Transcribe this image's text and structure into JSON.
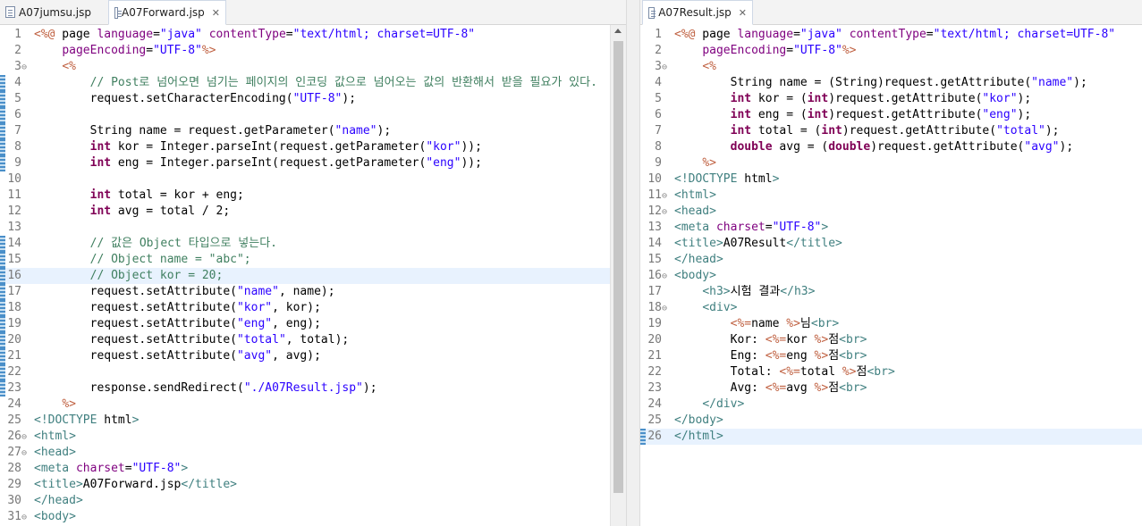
{
  "editor_left": {
    "tabs": [
      {
        "label": "A07jumsu.jsp",
        "active": false
      },
      {
        "label": "A07Forward.jsp",
        "active": true
      }
    ],
    "close_glyph": "✕",
    "highlight_line": 16,
    "lines": [
      {
        "n": "1",
        "f": "",
        "t": "<%@ page language=\"java\" contentType=\"text/html; charset=UTF-8\""
      },
      {
        "n": "2",
        "f": "",
        "t": "    pageEncoding=\"UTF-8\"%>"
      },
      {
        "n": "3",
        "f": "⊖",
        "t": "    <%"
      },
      {
        "n": "4",
        "f": "",
        "t": "        // Post로 넘어오면 넘기는 페이지의 인코딩 값으로 넘어오는 값의 반환해서 받을 필요가 있다."
      },
      {
        "n": "5",
        "f": "",
        "t": "        request.setCharacterEncoding(\"UTF-8\");"
      },
      {
        "n": "6",
        "f": "",
        "t": ""
      },
      {
        "n": "7",
        "f": "",
        "t": "        String name = request.getParameter(\"name\");"
      },
      {
        "n": "8",
        "f": "",
        "t": "        int kor = Integer.parseInt(request.getParameter(\"kor\"));"
      },
      {
        "n": "9",
        "f": "",
        "t": "        int eng = Integer.parseInt(request.getParameter(\"eng\"));"
      },
      {
        "n": "10",
        "f": "",
        "t": ""
      },
      {
        "n": "11",
        "f": "",
        "t": "        int total = kor + eng;"
      },
      {
        "n": "12",
        "f": "",
        "t": "        int avg = total / 2;"
      },
      {
        "n": "13",
        "f": "",
        "t": ""
      },
      {
        "n": "14",
        "f": "",
        "t": "        // 값은 Object 타입으로 넣는다."
      },
      {
        "n": "15",
        "f": "",
        "t": "        // Object name = \"abc\";"
      },
      {
        "n": "16",
        "f": "",
        "t": "        // Object kor = 20;"
      },
      {
        "n": "17",
        "f": "",
        "t": "        request.setAttribute(\"name\", name);"
      },
      {
        "n": "18",
        "f": "",
        "t": "        request.setAttribute(\"kor\", kor);"
      },
      {
        "n": "19",
        "f": "",
        "t": "        request.setAttribute(\"eng\", eng);"
      },
      {
        "n": "20",
        "f": "",
        "t": "        request.setAttribute(\"total\", total);"
      },
      {
        "n": "21",
        "f": "",
        "t": "        request.setAttribute(\"avg\", avg);"
      },
      {
        "n": "22",
        "f": "",
        "t": ""
      },
      {
        "n": "23",
        "f": "",
        "t": "        response.sendRedirect(\"./A07Result.jsp\");"
      },
      {
        "n": "24",
        "f": "",
        "t": "    %>"
      },
      {
        "n": "25",
        "f": "",
        "t": "<!DOCTYPE html>"
      },
      {
        "n": "26",
        "f": "⊖",
        "t": "<html>"
      },
      {
        "n": "27",
        "f": "⊖",
        "t": "<head>"
      },
      {
        "n": "28",
        "f": "",
        "t": "<meta charset=\"UTF-8\">"
      },
      {
        "n": "29",
        "f": "",
        "t": "<title>A07Forward.jsp</title>"
      },
      {
        "n": "30",
        "f": "",
        "t": "</head>"
      },
      {
        "n": "31",
        "f": "⊖",
        "t": "<body>"
      }
    ]
  },
  "editor_right": {
    "tabs": [
      {
        "label": "A07Result.jsp",
        "active": true
      }
    ],
    "close_glyph": "✕",
    "highlight_line": 26,
    "lines": [
      {
        "n": "1",
        "f": "",
        "t": "<%@ page language=\"java\" contentType=\"text/html; charset=UTF-8\""
      },
      {
        "n": "2",
        "f": "",
        "t": "    pageEncoding=\"UTF-8\"%>"
      },
      {
        "n": "3",
        "f": "⊖",
        "t": "    <%"
      },
      {
        "n": "4",
        "f": "",
        "t": "        String name = (String)request.getAttribute(\"name\");"
      },
      {
        "n": "5",
        "f": "",
        "t": "        int kor = (int)request.getAttribute(\"kor\");"
      },
      {
        "n": "6",
        "f": "",
        "t": "        int eng = (int)request.getAttribute(\"eng\");"
      },
      {
        "n": "7",
        "f": "",
        "t": "        int total = (int)request.getAttribute(\"total\");"
      },
      {
        "n": "8",
        "f": "",
        "t": "        double avg = (double)request.getAttribute(\"avg\");"
      },
      {
        "n": "9",
        "f": "",
        "t": "    %>"
      },
      {
        "n": "10",
        "f": "",
        "t": "<!DOCTYPE html>"
      },
      {
        "n": "11",
        "f": "⊖",
        "t": "<html>"
      },
      {
        "n": "12",
        "f": "⊖",
        "t": "<head>"
      },
      {
        "n": "13",
        "f": "",
        "t": "<meta charset=\"UTF-8\">"
      },
      {
        "n": "14",
        "f": "",
        "t": "<title>A07Result</title>"
      },
      {
        "n": "15",
        "f": "",
        "t": "</head>"
      },
      {
        "n": "16",
        "f": "⊖",
        "t": "<body>"
      },
      {
        "n": "17",
        "f": "",
        "t": "    <h3>시험 결과</h3>"
      },
      {
        "n": "18",
        "f": "⊖",
        "t": "    <div>"
      },
      {
        "n": "19",
        "f": "",
        "t": "        <%=name %>님<br>"
      },
      {
        "n": "20",
        "f": "",
        "t": "        Kor: <%=kor %>점<br>"
      },
      {
        "n": "21",
        "f": "",
        "t": "        Eng: <%=eng %>점<br>"
      },
      {
        "n": "22",
        "f": "",
        "t": "        Total: <%=total %>점<br>"
      },
      {
        "n": "23",
        "f": "",
        "t": "        Avg: <%=avg %>점<br>"
      },
      {
        "n": "24",
        "f": "",
        "t": "    </div>"
      },
      {
        "n": "25",
        "f": "",
        "t": "</body>"
      },
      {
        "n": "26",
        "f": "",
        "t": "</html>"
      }
    ]
  },
  "colors": {
    "keyword": "#7f0055",
    "string": "#2a00ff",
    "comment": "#3f7f5f",
    "tag": "#3f7f7f",
    "jsp": "#bf5f3f",
    "attr": "#7f007f",
    "plain": "#000000",
    "line_number": "#787878",
    "current_line": "#e8f2fe"
  }
}
